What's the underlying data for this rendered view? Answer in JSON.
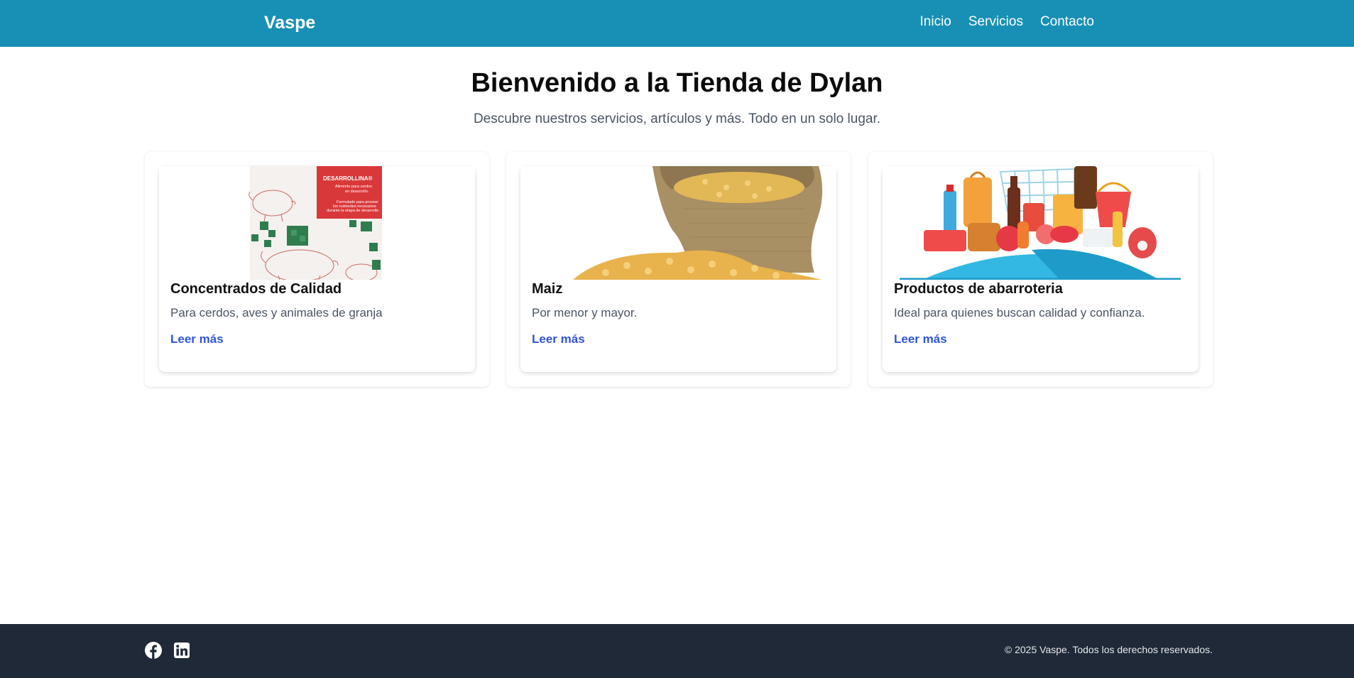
{
  "header": {
    "brand": "Vaspe",
    "nav": [
      "Inicio",
      "Servicios",
      "Contacto"
    ]
  },
  "hero": {
    "title": "Bienvenido a la Tienda de Dylan",
    "subtitle": "Descubre nuestros servicios, artículos y más. Todo en un solo lugar."
  },
  "cards": [
    {
      "title": "Concentrados de Calidad",
      "description": "Para cerdos, aves y animales de granja",
      "link": "Leer más",
      "image": {
        "brand_text": "DESARROLLINA®",
        "line1": "Alimento para cerdos",
        "line2": "en desarrollo.",
        "line3": "Formulado para proveer",
        "line4": "los nutrientes necesarios",
        "line5": "durante la etapa de desarrollo."
      }
    },
    {
      "title": "Maiz",
      "description": "Por menor y mayor.",
      "link": "Leer más"
    },
    {
      "title": "Productos de abarroteria",
      "description": "Ideal para quienes buscan calidad y confianza.",
      "link": "Leer más"
    }
  ],
  "footer": {
    "social_icons": [
      "facebook-icon",
      "linkedin-icon"
    ],
    "copyright": "© 2025 Vaspe. Todos los derechos reservados."
  },
  "colors": {
    "navbar": "#1890b5",
    "footer": "#1f2937",
    "link": "#2f55d4"
  }
}
